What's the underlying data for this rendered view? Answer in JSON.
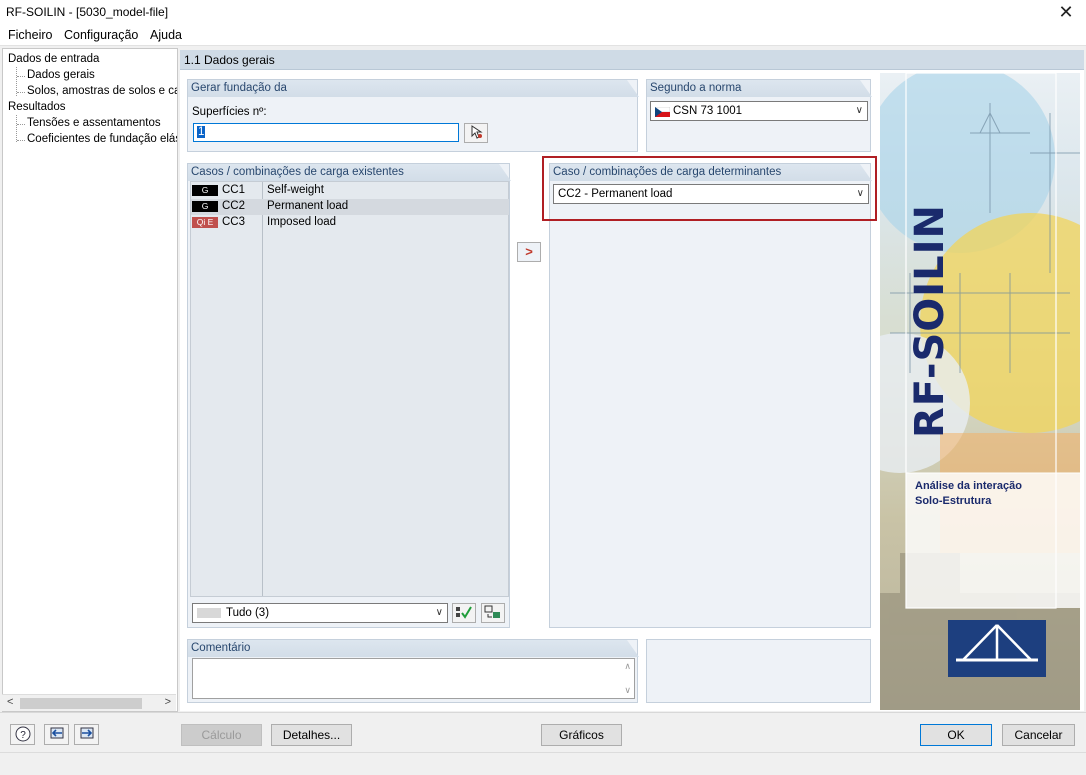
{
  "window": {
    "title": "RF-SOILIN - [5030_model-file]",
    "close_glyph": "✕"
  },
  "menu": [
    "Ficheiro",
    "Configuração",
    "Ajuda"
  ],
  "nav": {
    "dados_entrada": "Dados de entrada",
    "dados_gerais": "Dados gerais",
    "solos": "Solos, amostras de solos e cam",
    "resultados": "Resultados",
    "tensoes": "Tensões e assentamentos",
    "coeficientes": "Coeficientes de fundação elást"
  },
  "main": {
    "header": "1.1 Dados gerais",
    "gerar": {
      "title": "Gerar fundação da",
      "label": "Superfícies nº:",
      "value": "1"
    },
    "norma": {
      "title": "Segundo a norma",
      "value": "CSN 73 1001"
    },
    "existentes": {
      "title": "Casos / combinações de carga existentes",
      "rows": [
        {
          "tag": "G",
          "tag_color": "#000000",
          "id": "CC1",
          "name": "Self-weight"
        },
        {
          "tag": "G",
          "tag_color": "#000000",
          "id": "CC2",
          "name": "Permanent load"
        },
        {
          "tag": "Qi E",
          "tag_color": "#c0504d",
          "id": "CC3",
          "name": "Imposed load"
        }
      ],
      "filter": "Tudo (3)"
    },
    "transfer_glyph": ">",
    "determinantes": {
      "title": "Caso / combinações de carga determinantes",
      "value": "CC2 - Permanent load"
    },
    "comentario": {
      "title": "Comentário"
    }
  },
  "brand": {
    "logo_text": "RF-SOILIN",
    "subtitle_line1": "Análise da interação",
    "subtitle_line2": "Solo-Estrutura"
  },
  "buttons": {
    "calculo": "Cálculo",
    "detalhes": "Detalhes...",
    "graficos": "Gráficos",
    "ok": "OK",
    "cancelar": "Cancelar"
  },
  "colors": {
    "highlight_border": "#b01f24",
    "panel_title": "#28476e",
    "accent": "#0078d7"
  }
}
